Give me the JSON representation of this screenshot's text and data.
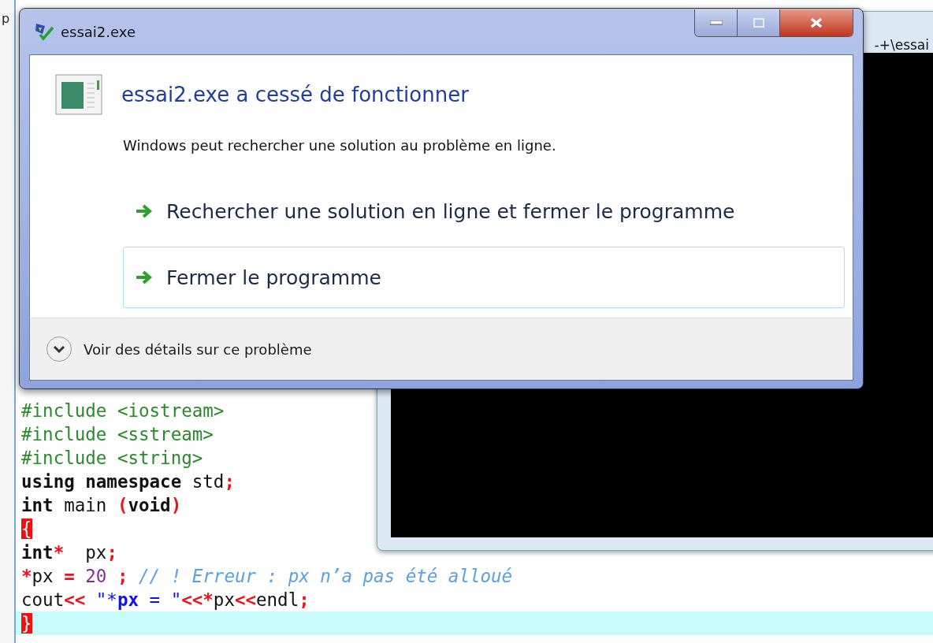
{
  "background_fragment": "p",
  "editor": {
    "lines": [
      {
        "current": false,
        "tokens": [
          {
            "kind": "preproc",
            "text": "#include <iostream>"
          }
        ]
      },
      {
        "current": false,
        "tokens": [
          {
            "kind": "preproc",
            "text": "#include <sstream>"
          }
        ]
      },
      {
        "current": false,
        "tokens": [
          {
            "kind": "preproc",
            "text": "#include <string>"
          }
        ]
      },
      {
        "current": false,
        "tokens": [
          {
            "kind": "keyword",
            "text": "using namespace"
          },
          {
            "kind": "plain",
            "text": " std"
          },
          {
            "kind": "op",
            "text": ";"
          }
        ]
      },
      {
        "current": false,
        "tokens": [
          {
            "kind": "keyword",
            "text": "int"
          },
          {
            "kind": "plain",
            "text": " main "
          },
          {
            "kind": "op",
            "text": "("
          },
          {
            "kind": "keyword",
            "text": "void"
          },
          {
            "kind": "op",
            "text": ")"
          }
        ]
      },
      {
        "current": false,
        "tokens": [
          {
            "kind": "brace",
            "text": "{"
          }
        ]
      },
      {
        "current": false,
        "tokens": [
          {
            "kind": "keyword",
            "text": "int"
          },
          {
            "kind": "op",
            "text": "*"
          },
          {
            "kind": "plain",
            "text": "  px"
          },
          {
            "kind": "op",
            "text": ";"
          }
        ]
      },
      {
        "current": false,
        "tokens": [
          {
            "kind": "op",
            "text": "*"
          },
          {
            "kind": "plain",
            "text": "px "
          },
          {
            "kind": "op",
            "text": "= "
          },
          {
            "kind": "num",
            "text": "20 "
          },
          {
            "kind": "op",
            "text": "; "
          },
          {
            "kind": "comment",
            "text": "// ! Erreur : px n’a pas été alloué"
          }
        ]
      },
      {
        "current": false,
        "tokens": [
          {
            "kind": "plain",
            "text": "cout"
          },
          {
            "kind": "op",
            "text": "<< "
          },
          {
            "kind": "str",
            "text": "\"*"
          },
          {
            "kind": "strbold",
            "text": "px"
          },
          {
            "kind": "str",
            "text": " = \""
          },
          {
            "kind": "op",
            "text": "<<*"
          },
          {
            "kind": "plain",
            "text": "px"
          },
          {
            "kind": "op",
            "text": "<<"
          },
          {
            "kind": "plain",
            "text": "endl"
          },
          {
            "kind": "op",
            "text": ";"
          }
        ]
      },
      {
        "current": true,
        "tokens": [
          {
            "kind": "brace",
            "text": "}"
          }
        ]
      }
    ]
  },
  "console": {
    "title": "-+\\essai"
  },
  "dialog": {
    "title": "essai2.exe",
    "heading": "essai2.exe a cessé de fonctionner",
    "message": "Windows peut rechercher une solution au problème en ligne.",
    "options": [
      {
        "label": "Rechercher une solution en ligne et fermer le programme",
        "highlighted": false
      },
      {
        "label": "Fermer le programme",
        "highlighted": true
      }
    ],
    "details": "Voir des détails sur ce problème"
  }
}
